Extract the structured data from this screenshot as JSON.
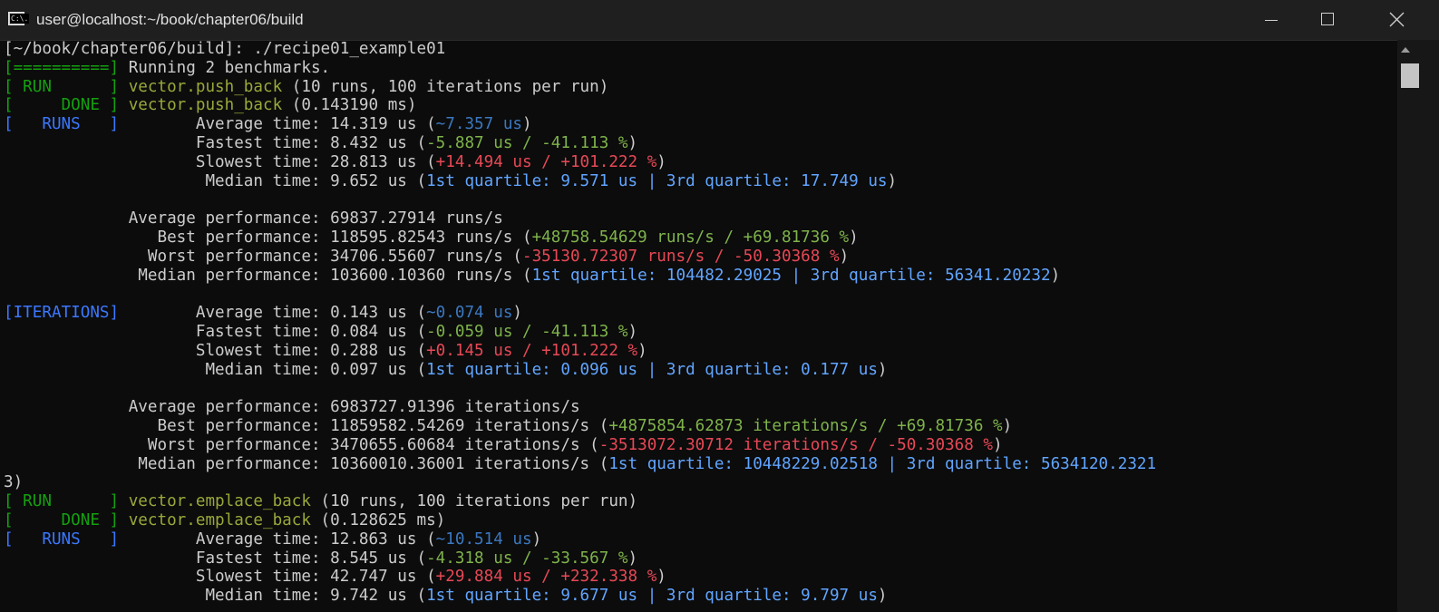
{
  "window": {
    "title": "user@localhost:~/book/chapter06/build",
    "icon": "console-icon",
    "icon_text": "C:\\.",
    "controls": [
      "minimize-icon",
      "maximize-icon",
      "close-icon"
    ]
  },
  "terminal": {
    "lines": [
      [
        {
          "t": "[~/book/chapter06/build]: ./recipe01_example01",
          "c": "def"
        }
      ],
      [
        {
          "t": "[==========]",
          "c": "green"
        },
        {
          "t": " Running 2 benchmarks.",
          "c": "def"
        }
      ],
      [
        {
          "t": "[ RUN      ]",
          "c": "green"
        },
        {
          "t": " ",
          "c": "def"
        },
        {
          "t": "vector.push_back",
          "c": "olive"
        },
        {
          "t": " (10 runs, 100 iterations per run)",
          "c": "def"
        }
      ],
      [
        {
          "t": "[     DONE ]",
          "c": "green"
        },
        {
          "t": " ",
          "c": "def"
        },
        {
          "t": "vector.push_back",
          "c": "olive"
        },
        {
          "t": " (0.143190 ms)",
          "c": "def"
        }
      ],
      [
        {
          "t": "[   RUNS   ]",
          "c": "blue"
        },
        {
          "t": "        Average time: 14.319 us (",
          "c": "def"
        },
        {
          "t": "~7.357 us",
          "c": "dblue"
        },
        {
          "t": ")",
          "c": "def"
        }
      ],
      [
        {
          "t": "                    Fastest time: 8.432 us (",
          "c": "def"
        },
        {
          "t": "-5.887 us / -41.113 %",
          "c": "lgreen"
        },
        {
          "t": ")",
          "c": "def"
        }
      ],
      [
        {
          "t": "                    Slowest time: 28.813 us (",
          "c": "def"
        },
        {
          "t": "+14.494 us / +101.222 %",
          "c": "red"
        },
        {
          "t": ")",
          "c": "def"
        }
      ],
      [
        {
          "t": "                     Median time: 9.652 us (",
          "c": "def"
        },
        {
          "t": "1st quartile: 9.571 us | 3rd quartile: 17.749 us",
          "c": "lblue"
        },
        {
          "t": ")",
          "c": "def"
        }
      ],
      [
        {
          "t": "",
          "c": "def"
        }
      ],
      [
        {
          "t": "             Average performance: 69837.27914 runs/s",
          "c": "def"
        }
      ],
      [
        {
          "t": "                Best performance: 118595.82543 runs/s (",
          "c": "def"
        },
        {
          "t": "+48758.54629 runs/s / +69.81736 %",
          "c": "lgreen"
        },
        {
          "t": ")",
          "c": "def"
        }
      ],
      [
        {
          "t": "               Worst performance: 34706.55607 runs/s (",
          "c": "def"
        },
        {
          "t": "-35130.72307 runs/s / -50.30368 %",
          "c": "red"
        },
        {
          "t": ")",
          "c": "def"
        }
      ],
      [
        {
          "t": "              Median performance: 103600.10360 runs/s (",
          "c": "def"
        },
        {
          "t": "1st quartile: 104482.29025 | 3rd quartile: 56341.20232",
          "c": "lblue"
        },
        {
          "t": ")",
          "c": "def"
        }
      ],
      [
        {
          "t": "",
          "c": "def"
        }
      ],
      [
        {
          "t": "[ITERATIONS]",
          "c": "blue"
        },
        {
          "t": "        Average time: 0.143 us (",
          "c": "def"
        },
        {
          "t": "~0.074 us",
          "c": "dblue"
        },
        {
          "t": ")",
          "c": "def"
        }
      ],
      [
        {
          "t": "                    Fastest time: 0.084 us (",
          "c": "def"
        },
        {
          "t": "-0.059 us / -41.113 %",
          "c": "lgreen"
        },
        {
          "t": ")",
          "c": "def"
        }
      ],
      [
        {
          "t": "                    Slowest time: 0.288 us (",
          "c": "def"
        },
        {
          "t": "+0.145 us / +101.222 %",
          "c": "red"
        },
        {
          "t": ")",
          "c": "def"
        }
      ],
      [
        {
          "t": "                     Median time: 0.097 us (",
          "c": "def"
        },
        {
          "t": "1st quartile: 0.096 us | 3rd quartile: 0.177 us",
          "c": "lblue"
        },
        {
          "t": ")",
          "c": "def"
        }
      ],
      [
        {
          "t": "",
          "c": "def"
        }
      ],
      [
        {
          "t": "             Average performance: 6983727.91396 iterations/s",
          "c": "def"
        }
      ],
      [
        {
          "t": "                Best performance: 11859582.54269 iterations/s (",
          "c": "def"
        },
        {
          "t": "+4875854.62873 iterations/s / +69.81736 %",
          "c": "lgreen"
        },
        {
          "t": ")",
          "c": "def"
        }
      ],
      [
        {
          "t": "               Worst performance: 3470655.60684 iterations/s (",
          "c": "def"
        },
        {
          "t": "-3513072.30712 iterations/s / -50.30368 %",
          "c": "red"
        },
        {
          "t": ")",
          "c": "def"
        }
      ],
      [
        {
          "t": "              Median performance: 10360010.36001 iterations/s (",
          "c": "def"
        },
        {
          "t": "1st quartile: 10448229.02518 | 3rd quartile: 5634120.2321",
          "c": "lblue"
        }
      ],
      [
        {
          "t": "3)",
          "c": "def"
        }
      ],
      [
        {
          "t": "[ RUN      ]",
          "c": "green"
        },
        {
          "t": " ",
          "c": "def"
        },
        {
          "t": "vector.emplace_back",
          "c": "olive"
        },
        {
          "t": " (10 runs, 100 iterations per run)",
          "c": "def"
        }
      ],
      [
        {
          "t": "[     DONE ]",
          "c": "green"
        },
        {
          "t": " ",
          "c": "def"
        },
        {
          "t": "vector.emplace_back",
          "c": "olive"
        },
        {
          "t": " (0.128625 ms)",
          "c": "def"
        }
      ],
      [
        {
          "t": "[   RUNS   ]",
          "c": "blue"
        },
        {
          "t": "        Average time: 12.863 us (",
          "c": "def"
        },
        {
          "t": "~10.514 us",
          "c": "dblue"
        },
        {
          "t": ")",
          "c": "def"
        }
      ],
      [
        {
          "t": "                    Fastest time: 8.545 us (",
          "c": "def"
        },
        {
          "t": "-4.318 us / -33.567 %",
          "c": "lgreen"
        },
        {
          "t": ")",
          "c": "def"
        }
      ],
      [
        {
          "t": "                    Slowest time: 42.747 us (",
          "c": "def"
        },
        {
          "t": "+29.884 us / +232.338 %",
          "c": "red"
        },
        {
          "t": ")",
          "c": "def"
        }
      ],
      [
        {
          "t": "                     Median time: 9.742 us (",
          "c": "def"
        },
        {
          "t": "1st quartile: 9.677 us | 3rd quartile: 9.797 us",
          "c": "lblue"
        },
        {
          "t": ")",
          "c": "def"
        }
      ]
    ]
  },
  "scrollbar": {
    "position_fraction": 0.0
  }
}
